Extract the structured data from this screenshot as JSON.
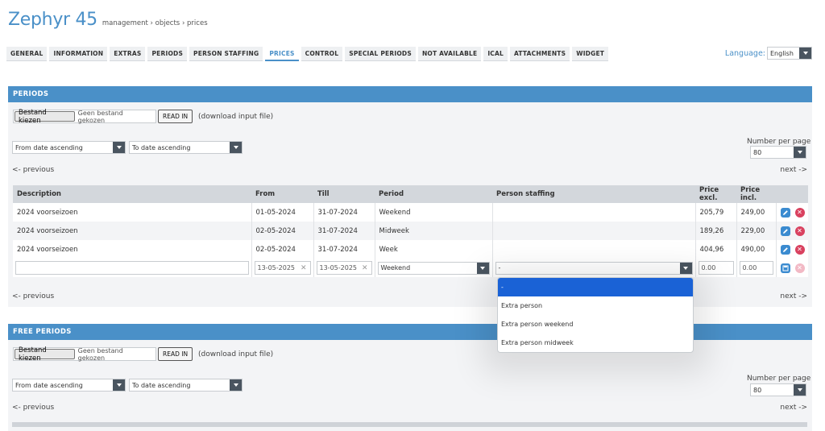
{
  "header": {
    "title": "Zephyr 45",
    "breadcrumb": "management › objects › prices"
  },
  "tabs": [
    "GENERAL",
    "INFORMATION",
    "EXTRAS",
    "PERIODS",
    "PERSON STAFFING",
    "PRICES",
    "CONTROL",
    "SPECIAL PERIODS",
    "NOT AVAILABLE",
    "ICAL",
    "ATTACHMENTS",
    "WIDGET"
  ],
  "active_tab": "PRICES",
  "language": {
    "label": "Language:",
    "value": "English"
  },
  "periods": {
    "heading": "PERIODS",
    "file_button": "Bestand kiezen",
    "file_none": "Geen bestand gekozen",
    "read_in": "READ IN",
    "download": "(download input file)",
    "sort1": "From date ascending",
    "sort2": "To date ascending",
    "per_page_label": "Number per page",
    "per_page_value": "80",
    "prev": "<- previous",
    "next": "next ->",
    "columns": [
      "Description",
      "From",
      "Till",
      "Period",
      "Person staffing",
      "Price excl.",
      "Price incl."
    ],
    "rows": [
      {
        "description": "2024 voorseizoen",
        "from": "01-05-2024",
        "till": "31-07-2024",
        "period": "Weekend",
        "staffing": "",
        "excl": "205,79",
        "incl": "249,00"
      },
      {
        "description": "2024 voorseizoen",
        "from": "02-05-2024",
        "till": "31-07-2024",
        "period": "Midweek",
        "staffing": "",
        "excl": "189,26",
        "incl": "229,00"
      },
      {
        "description": "2024 voorseizoen",
        "from": "02-05-2024",
        "till": "31-07-2024",
        "period": "Week",
        "staffing": "",
        "excl": "404,96",
        "incl": "490,00"
      }
    ],
    "new_row": {
      "from": "13-05-2025",
      "till": "13-05-2025",
      "period": "Weekend",
      "staffing": "-",
      "excl": "0.00",
      "incl": "0.00"
    },
    "staffing_options": [
      "-",
      "Extra person",
      "Extra person weekend",
      "Extra person midweek"
    ]
  },
  "free_periods": {
    "heading": "FREE PERIODS",
    "file_button": "Bestand kiezen",
    "file_none": "Geen bestand gekozen",
    "read_in": "READ IN",
    "download": "(download input file)",
    "sort1": "From date ascending",
    "sort2": "To date ascending",
    "per_page_label": "Number per page",
    "per_page_value": "80",
    "prev": "<- previous",
    "next": "next ->"
  },
  "icons": {
    "edit": "pencil-icon",
    "delete": "close-circle-icon",
    "save": "save-icon",
    "clear": "x-icon"
  },
  "colors": {
    "accent": "#4a90c8",
    "danger": "#d9415f",
    "selected": "#1a62d6"
  }
}
